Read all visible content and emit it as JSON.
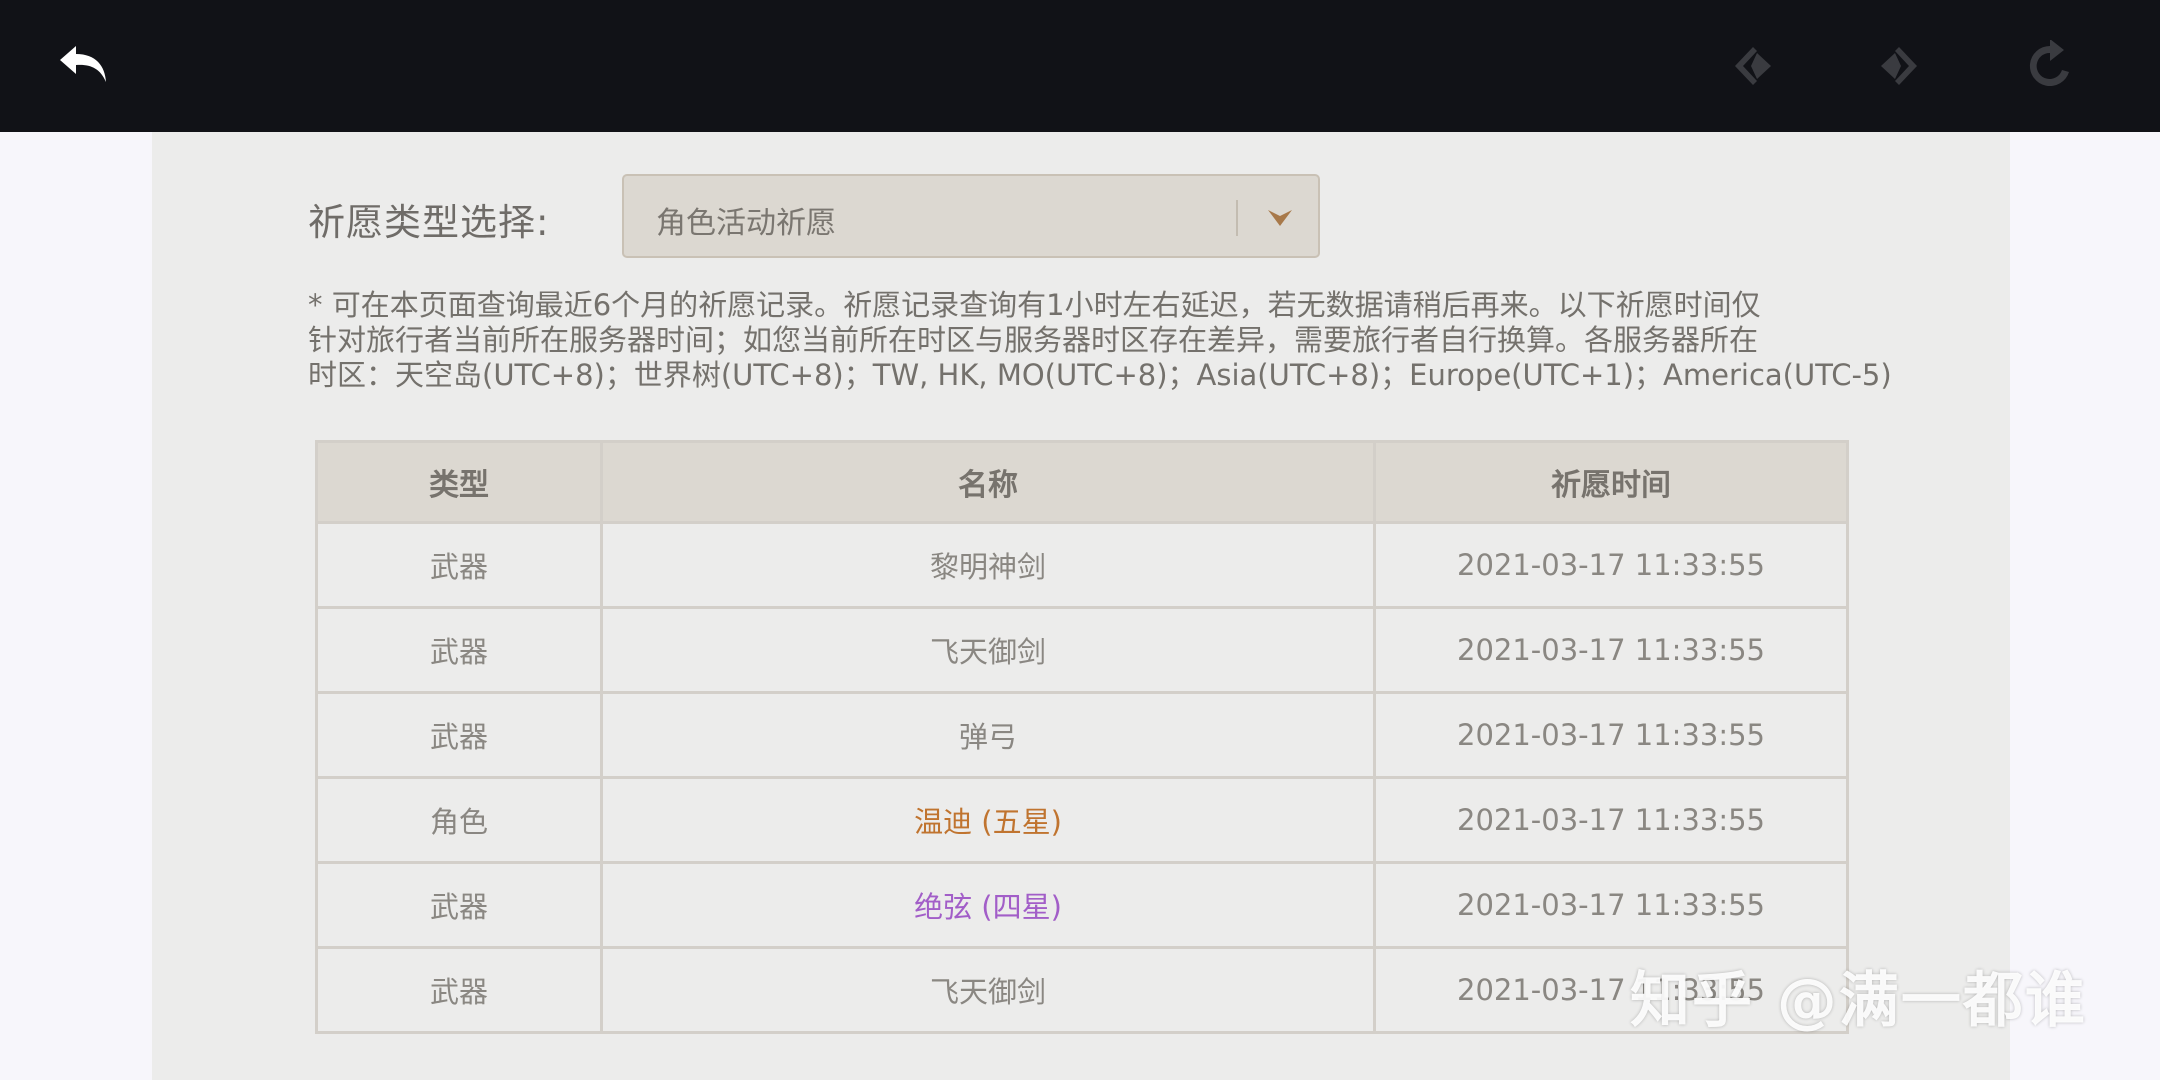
{
  "toolbar": {
    "back_icon": "back-arrow-icon",
    "prev_icon": "prev-page-icon",
    "next_icon": "next-page-icon",
    "refresh_icon": "refresh-icon"
  },
  "filter": {
    "label": "祈愿类型选择:",
    "selected": "角色活动祈愿"
  },
  "notice": {
    "line1": "* 可在本页面查询最近6个月的祈愿记录。祈愿记录查询有1小时左右延迟，若无数据请稍后再来。以下祈愿时间仅",
    "line2": "针对旅行者当前所在服务器时间；如您当前所在时区与服务器时区存在差异，需要旅行者自行换算。各服务器所在",
    "line3": "时区：天空岛(UTC+8)；世界树(UTC+8)；TW, HK, MO(UTC+8)；Asia(UTC+8)；Europe(UTC+1)；America(UTC-5)"
  },
  "table": {
    "headers": [
      "类型",
      "名称",
      "祈愿时间"
    ],
    "rows": [
      {
        "type": "武器",
        "name": "黎明神剑",
        "time": "2021-03-17 11:33:55"
      },
      {
        "type": "武器",
        "name": "飞天御剑",
        "time": "2021-03-17 11:33:55"
      },
      {
        "type": "武器",
        "name": "弹弓",
        "time": "2021-03-17 11:33:55"
      },
      {
        "type": "角色",
        "name": "温迪 (五星)",
        "time": "2021-03-17 11:33:55"
      },
      {
        "type": "武器",
        "name": "绝弦 (四星)",
        "time": "2021-03-17 11:33:55"
      },
      {
        "type": "武器",
        "name": "飞天御剑",
        "time": "2021-03-17 11:33:55"
      }
    ]
  },
  "watermark": "知乎 @满一都谁",
  "colors": {
    "five_star": "#c0742f",
    "four_star": "#a25ec8",
    "topbar": "#111217"
  }
}
